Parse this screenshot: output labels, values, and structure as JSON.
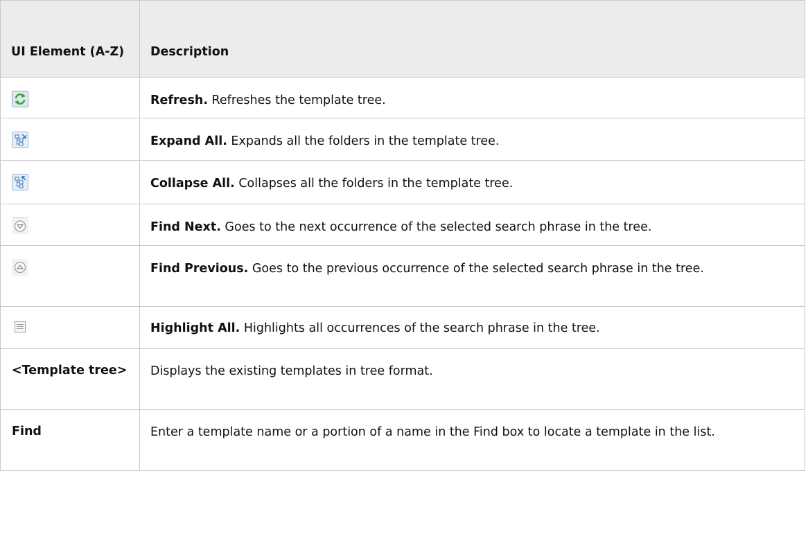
{
  "table": {
    "headers": [
      "UI Element (A-Z)",
      "Description"
    ],
    "rows": [
      {
        "element": {
          "type": "icon",
          "icon": "refresh-icon"
        },
        "term": "Refresh.",
        "description": " Refreshes the template tree."
      },
      {
        "element": {
          "type": "icon",
          "icon": "expand-all-icon"
        },
        "term": "Expand All.",
        "description": " Expands all the folders in the template tree."
      },
      {
        "element": {
          "type": "icon",
          "icon": "collapse-all-icon"
        },
        "term": "Collapse All.",
        "description": " Collapses all the folders in the template tree."
      },
      {
        "element": {
          "type": "icon",
          "icon": "find-next-icon"
        },
        "term": "Find Next.",
        "description": " Goes to the next occurrence of the selected search phrase in the tree."
      },
      {
        "element": {
          "type": "icon",
          "icon": "find-previous-icon"
        },
        "term": "Find Previous.",
        "description": " Goes to the previous occurrence of the selected search phrase in the tree."
      },
      {
        "element": {
          "type": "icon",
          "icon": "highlight-all-icon"
        },
        "term": "Highlight All.",
        "description": " Highlights all occurrences of the search phrase in the tree."
      },
      {
        "element": {
          "type": "text",
          "text": "<Template tree>"
        },
        "term": "",
        "description": "Displays the existing templates in tree format."
      },
      {
        "element": {
          "type": "text",
          "text": "Find"
        },
        "term": "",
        "description": "Enter a template name or a portion of a name in the Find box to locate a template in the list."
      }
    ]
  },
  "colors": {
    "header_bg": "#ececec",
    "border": "#c8c8c8",
    "refresh_green": "#3aa52a",
    "icon_blue": "#2f6fb7"
  }
}
